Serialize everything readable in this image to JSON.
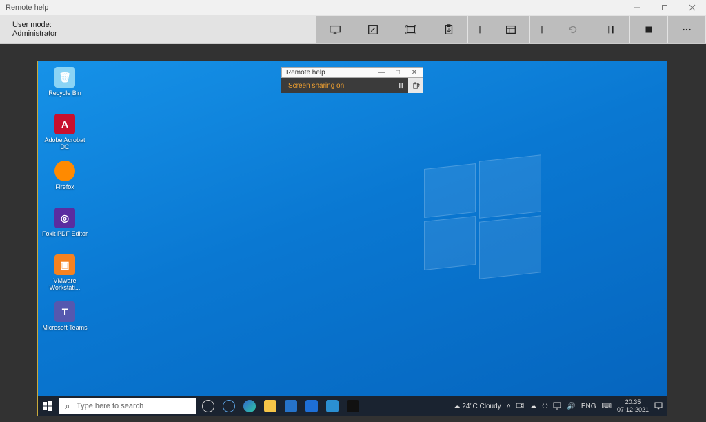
{
  "window": {
    "title": "Remote help"
  },
  "toolbar": {
    "usermode_label": "User mode:",
    "usermode_value": "Administrator"
  },
  "remote": {
    "floatbar": {
      "title": "Remote help",
      "message": "Screen sharing on"
    },
    "desktop_icons": [
      {
        "id": "recycle-bin",
        "label": "Recycle Bin",
        "glyph": "🗑",
        "cls": "bin"
      },
      {
        "id": "acrobat",
        "label": "Adobe Acrobat DC",
        "glyph": "A",
        "cls": "acro"
      },
      {
        "id": "firefox",
        "label": "Firefox",
        "glyph": "",
        "cls": "ff"
      },
      {
        "id": "foxit",
        "label": "Foxit PDF Editor",
        "glyph": "◎",
        "cls": "foxit"
      },
      {
        "id": "vmware",
        "label": "VMware Workstati...",
        "glyph": "▣",
        "cls": "vm"
      },
      {
        "id": "teams",
        "label": "Microsoft Teams",
        "glyph": "T",
        "cls": "teams"
      }
    ],
    "taskbar": {
      "search_placeholder": "Type here to search",
      "weather": "24°C  Cloudy",
      "lang": "ENG",
      "time": "20:35",
      "date": "07-12-2021"
    }
  }
}
